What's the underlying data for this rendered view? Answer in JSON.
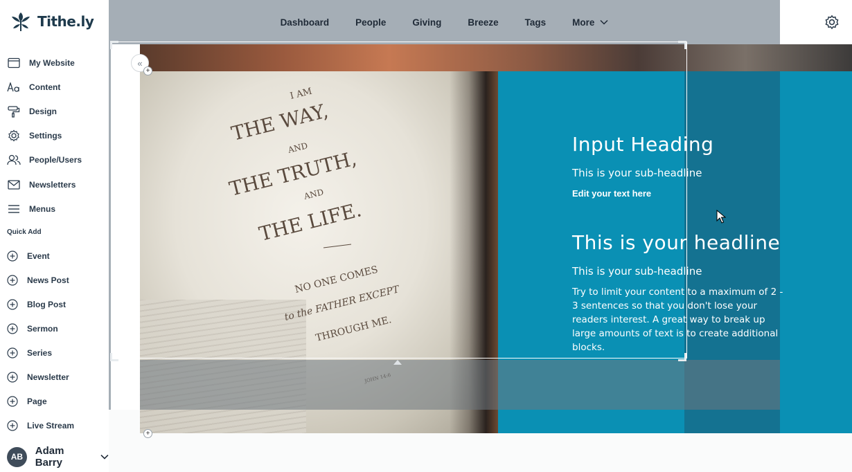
{
  "brand": {
    "name": "Tithe.ly"
  },
  "sidebar": {
    "items": [
      {
        "label": "My Website",
        "icon": "browser-window-icon"
      },
      {
        "label": "Content",
        "icon": "text-aa-icon"
      },
      {
        "label": "Design",
        "icon": "paint-roller-icon"
      },
      {
        "label": "Settings",
        "icon": "gear-icon"
      },
      {
        "label": "People/Users",
        "icon": "people-icon"
      },
      {
        "label": "Newsletters",
        "icon": "envelope-icon"
      },
      {
        "label": "Menus",
        "icon": "hamburger-menu-icon"
      }
    ],
    "quick_add_title": "Quick Add",
    "quick_add": [
      {
        "label": "Event"
      },
      {
        "label": "News Post"
      },
      {
        "label": "Blog Post"
      },
      {
        "label": "Sermon"
      },
      {
        "label": "Series"
      },
      {
        "label": "Newsletter"
      },
      {
        "label": "Page"
      },
      {
        "label": "Live Stream"
      }
    ],
    "user": {
      "initials": "AB",
      "name": "Adam Barry"
    }
  },
  "topnav": {
    "items": [
      "Dashboard",
      "People",
      "Giving",
      "Breeze",
      "Tags"
    ],
    "more_label": "More"
  },
  "hero": {
    "input_heading": "Input Heading",
    "sub_headline_1": "This is your sub-headline",
    "edit_text": "Edit your text here",
    "headline": "This is your headline",
    "sub_headline_2": "This is your sub-headline",
    "body": "Try to limit your content to a maximum of 2 - 3 sentences so that you don't lose your readers interest. A great way to break up large amounts of text is to create additional blocks."
  },
  "colors": {
    "teal": "#0a90b4",
    "topnav_bg": "#a5aeb6",
    "text_dark": "#1f2a37"
  }
}
